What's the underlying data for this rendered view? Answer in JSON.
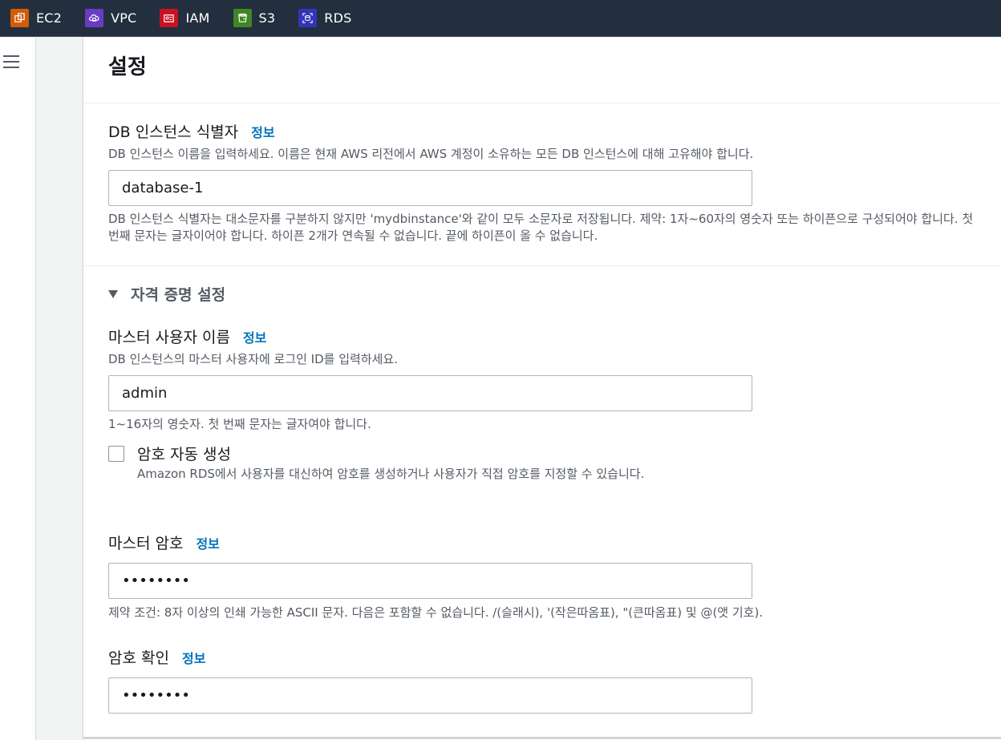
{
  "topbar": {
    "services": [
      {
        "label": "EC2",
        "icon": "ec2-icon",
        "color": "#d45b07"
      },
      {
        "label": "VPC",
        "icon": "vpc-icon",
        "color": "#693cc5"
      },
      {
        "label": "IAM",
        "icon": "iam-icon",
        "color": "#c7131f"
      },
      {
        "label": "S3",
        "icon": "s3-icon",
        "color": "#3f8624"
      },
      {
        "label": "RDS",
        "icon": "rds-icon",
        "color": "#3334b9"
      }
    ]
  },
  "nav": {
    "menu_icon": "hamburger-menu-icon"
  },
  "panel": {
    "title": "설정",
    "instance_id": {
      "label": "DB 인스턴스 식별자",
      "info": "정보",
      "description": "DB 인스턴스 이름을 입력하세요. 이름은 현재 AWS 리전에서 AWS 계정이 소유하는 모든 DB 인스턴스에 대해 고유해야 합니다.",
      "value": "database-1",
      "constraint": "DB 인스턴스 식별자는 대소문자를 구분하지 않지만 'mydbinstance'와 같이 모두 소문자로 저장됩니다. 제약: 1자~60자의 영숫자 또는 하이픈으로 구성되어야 합니다. 첫 번째 문자는 글자이어야 합니다. 하이픈 2개가 연속될 수 없습니다. 끝에 하이픈이 올 수 없습니다."
    },
    "credentials": {
      "section_label": "자격 증명 설정",
      "master_username": {
        "label": "마스터 사용자 이름",
        "info": "정보",
        "description": "DB 인스턴스의 마스터 사용자에 로그인 ID를 입력하세요.",
        "value": "admin",
        "constraint": "1~16자의 영숫자. 첫 번째 문자는 글자여야 합니다."
      },
      "auto_password": {
        "label": "암호 자동 생성",
        "description": "Amazon RDS에서 사용자를 대신하여 암호를 생성하거나 사용자가 직접 암호를 지정할 수 있습니다.",
        "checked": false
      },
      "master_password": {
        "label": "마스터 암호",
        "info": "정보",
        "value": "••••••••",
        "constraint": "제약 조건: 8자 이상의 인쇄 가능한 ASCII 문자. 다음은 포함할 수 없습니다. /(슬래시), '(작은따옴표), \"(큰따옴표) 및 @(앳 기호)."
      },
      "confirm_password": {
        "label": "암호 확인",
        "info": "정보",
        "value": "••••••••"
      }
    }
  }
}
